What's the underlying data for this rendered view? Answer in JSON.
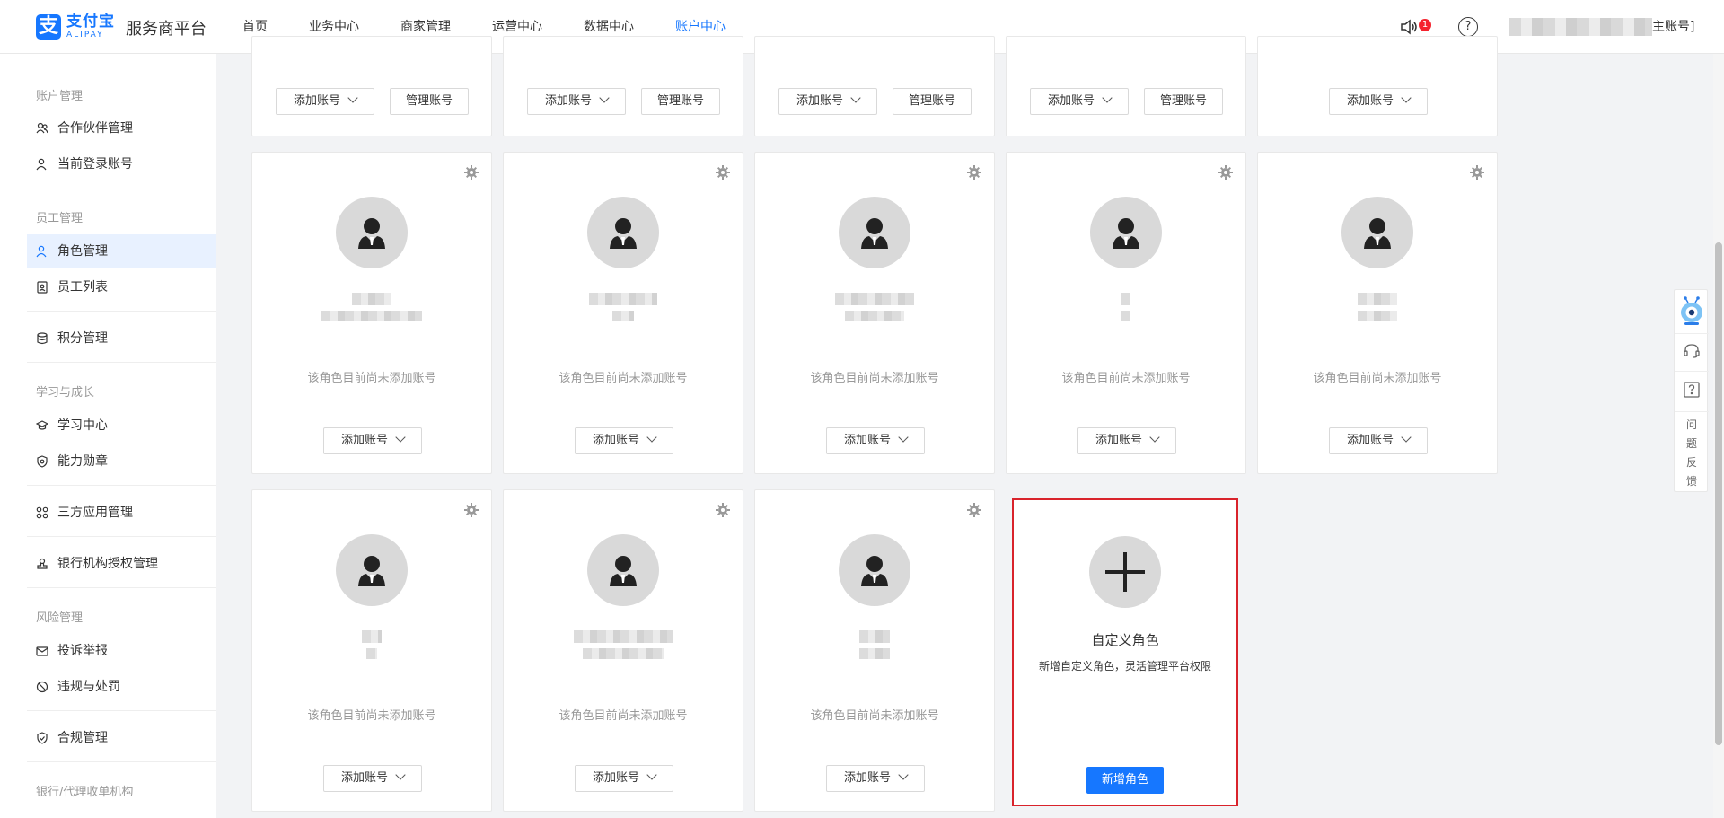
{
  "header": {
    "logo_cn": "支付宝",
    "logo_en": "ALIPAY",
    "platform": "服务商平台",
    "nav": [
      "首页",
      "业务中心",
      "商家管理",
      "运营中心",
      "数据中心",
      "账户中心"
    ],
    "active_nav": "账户中心",
    "notification_count": "1",
    "account_suffix": "主账号]"
  },
  "sidebar": {
    "sections": [
      {
        "title": "账户管理",
        "items": [
          "合作伙伴管理",
          "当前登录账号"
        ]
      },
      {
        "title": "员工管理",
        "items": [
          "角色管理",
          "员工列表"
        ]
      },
      {
        "title": "",
        "items": [
          "积分管理"
        ]
      },
      {
        "title": "学习与成长",
        "items": [
          "学习中心",
          "能力勋章"
        ]
      },
      {
        "title": "",
        "items": [
          "三方应用管理"
        ]
      },
      {
        "title": "",
        "items": [
          "银行机构授权管理"
        ]
      },
      {
        "title": "风险管理",
        "items": [
          "投诉举报",
          "违规与处罚"
        ]
      },
      {
        "title": "",
        "items": [
          "合规管理"
        ]
      },
      {
        "title": "银行/代理收单机构",
        "items": []
      }
    ],
    "active_item": "角色管理"
  },
  "cards": {
    "add_account_label": "添加账号",
    "manage_account_label": "管理账号",
    "empty_text": "该角色目前尚未添加账号"
  },
  "new_role": {
    "title": "自定义角色",
    "desc": "新增自定义角色，灵活管理平台权限",
    "button": "新增角色"
  },
  "float_tools": {
    "feedback": [
      "问",
      "题",
      "反",
      "馈"
    ]
  }
}
